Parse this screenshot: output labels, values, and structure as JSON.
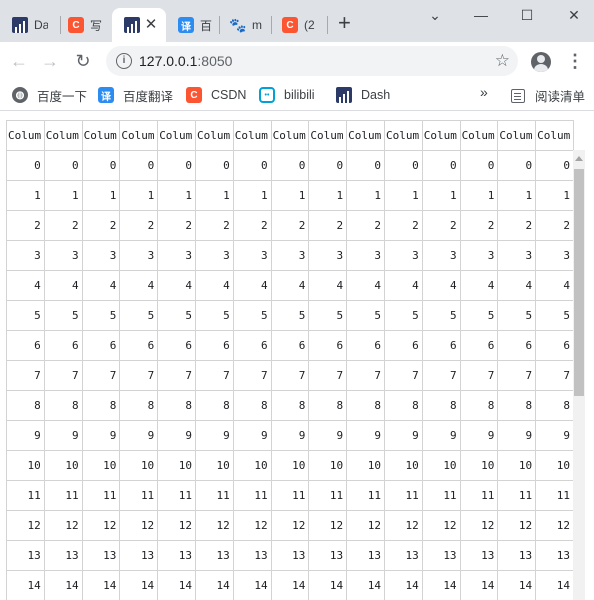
{
  "tabs": [
    {
      "title": "Da",
      "icon": "dash-icon"
    },
    {
      "title": "写",
      "icon": "csdn-icon"
    },
    {
      "title": "",
      "icon": "dash-icon"
    },
    {
      "title": "百",
      "icon": "baidu-translate-icon"
    },
    {
      "title": "m",
      "icon": "baidu-paw-icon"
    },
    {
      "title": "(2",
      "icon": "csdn-icon"
    }
  ],
  "toolbar": {
    "url_host": "127.0.0.1",
    "url_port": ":8050"
  },
  "bookmarks": [
    {
      "label": "百度一下",
      "icon": "globe-icon"
    },
    {
      "label": "百度翻译",
      "icon": "baidu-translate-icon"
    },
    {
      "label": "CSDN",
      "icon": "csdn-icon"
    },
    {
      "label": "bilibili",
      "icon": "bilibili-icon"
    },
    {
      "label": "Dash",
      "icon": "dash-icon"
    }
  ],
  "reading_list": "阅读清单",
  "colors": {
    "csdn": "#fc5531",
    "translate": "#2d8cf0",
    "dash": "#2b3a67",
    "bilibili": "#00a1d6"
  },
  "table": {
    "column_header": "Colum",
    "column_count": 15,
    "rows": [
      [
        "0",
        "0",
        "0",
        "0",
        "0",
        "0",
        "0",
        "0",
        "0",
        "0",
        "0",
        "0",
        "0",
        "0",
        "0"
      ],
      [
        "1",
        "1",
        "1",
        "1",
        "1",
        "1",
        "1",
        "1",
        "1",
        "1",
        "1",
        "1",
        "1",
        "1",
        "1"
      ],
      [
        "2",
        "2",
        "2",
        "2",
        "2",
        "2",
        "2",
        "2",
        "2",
        "2",
        "2",
        "2",
        "2",
        "2",
        "2"
      ],
      [
        "3",
        "3",
        "3",
        "3",
        "3",
        "3",
        "3",
        "3",
        "3",
        "3",
        "3",
        "3",
        "3",
        "3",
        "3"
      ],
      [
        "4",
        "4",
        "4",
        "4",
        "4",
        "4",
        "4",
        "4",
        "4",
        "4",
        "4",
        "4",
        "4",
        "4",
        "4"
      ],
      [
        "5",
        "5",
        "5",
        "5",
        "5",
        "5",
        "5",
        "5",
        "5",
        "5",
        "5",
        "5",
        "5",
        "5",
        "5"
      ],
      [
        "6",
        "6",
        "6",
        "6",
        "6",
        "6",
        "6",
        "6",
        "6",
        "6",
        "6",
        "6",
        "6",
        "6",
        "6"
      ],
      [
        "7",
        "7",
        "7",
        "7",
        "7",
        "7",
        "7",
        "7",
        "7",
        "7",
        "7",
        "7",
        "7",
        "7",
        "7"
      ],
      [
        "8",
        "8",
        "8",
        "8",
        "8",
        "8",
        "8",
        "8",
        "8",
        "8",
        "8",
        "8",
        "8",
        "8",
        "8"
      ],
      [
        "9",
        "9",
        "9",
        "9",
        "9",
        "9",
        "9",
        "9",
        "9",
        "9",
        "9",
        "9",
        "9",
        "9",
        "9"
      ],
      [
        "10",
        "10",
        "10",
        "10",
        "10",
        "10",
        "10",
        "10",
        "10",
        "10",
        "10",
        "10",
        "10",
        "10",
        "10"
      ],
      [
        "11",
        "11",
        "11",
        "11",
        "11",
        "11",
        "11",
        "11",
        "11",
        "11",
        "11",
        "11",
        "11",
        "11",
        "11"
      ],
      [
        "12",
        "12",
        "12",
        "12",
        "12",
        "12",
        "12",
        "12",
        "12",
        "12",
        "12",
        "12",
        "12",
        "12",
        "12"
      ],
      [
        "13",
        "13",
        "13",
        "13",
        "13",
        "13",
        "13",
        "13",
        "13",
        "13",
        "13",
        "13",
        "13",
        "13",
        "13"
      ],
      [
        "14",
        "14",
        "14",
        "14",
        "14",
        "14",
        "14",
        "14",
        "14",
        "14",
        "14",
        "14",
        "14",
        "14",
        "14"
      ]
    ]
  }
}
